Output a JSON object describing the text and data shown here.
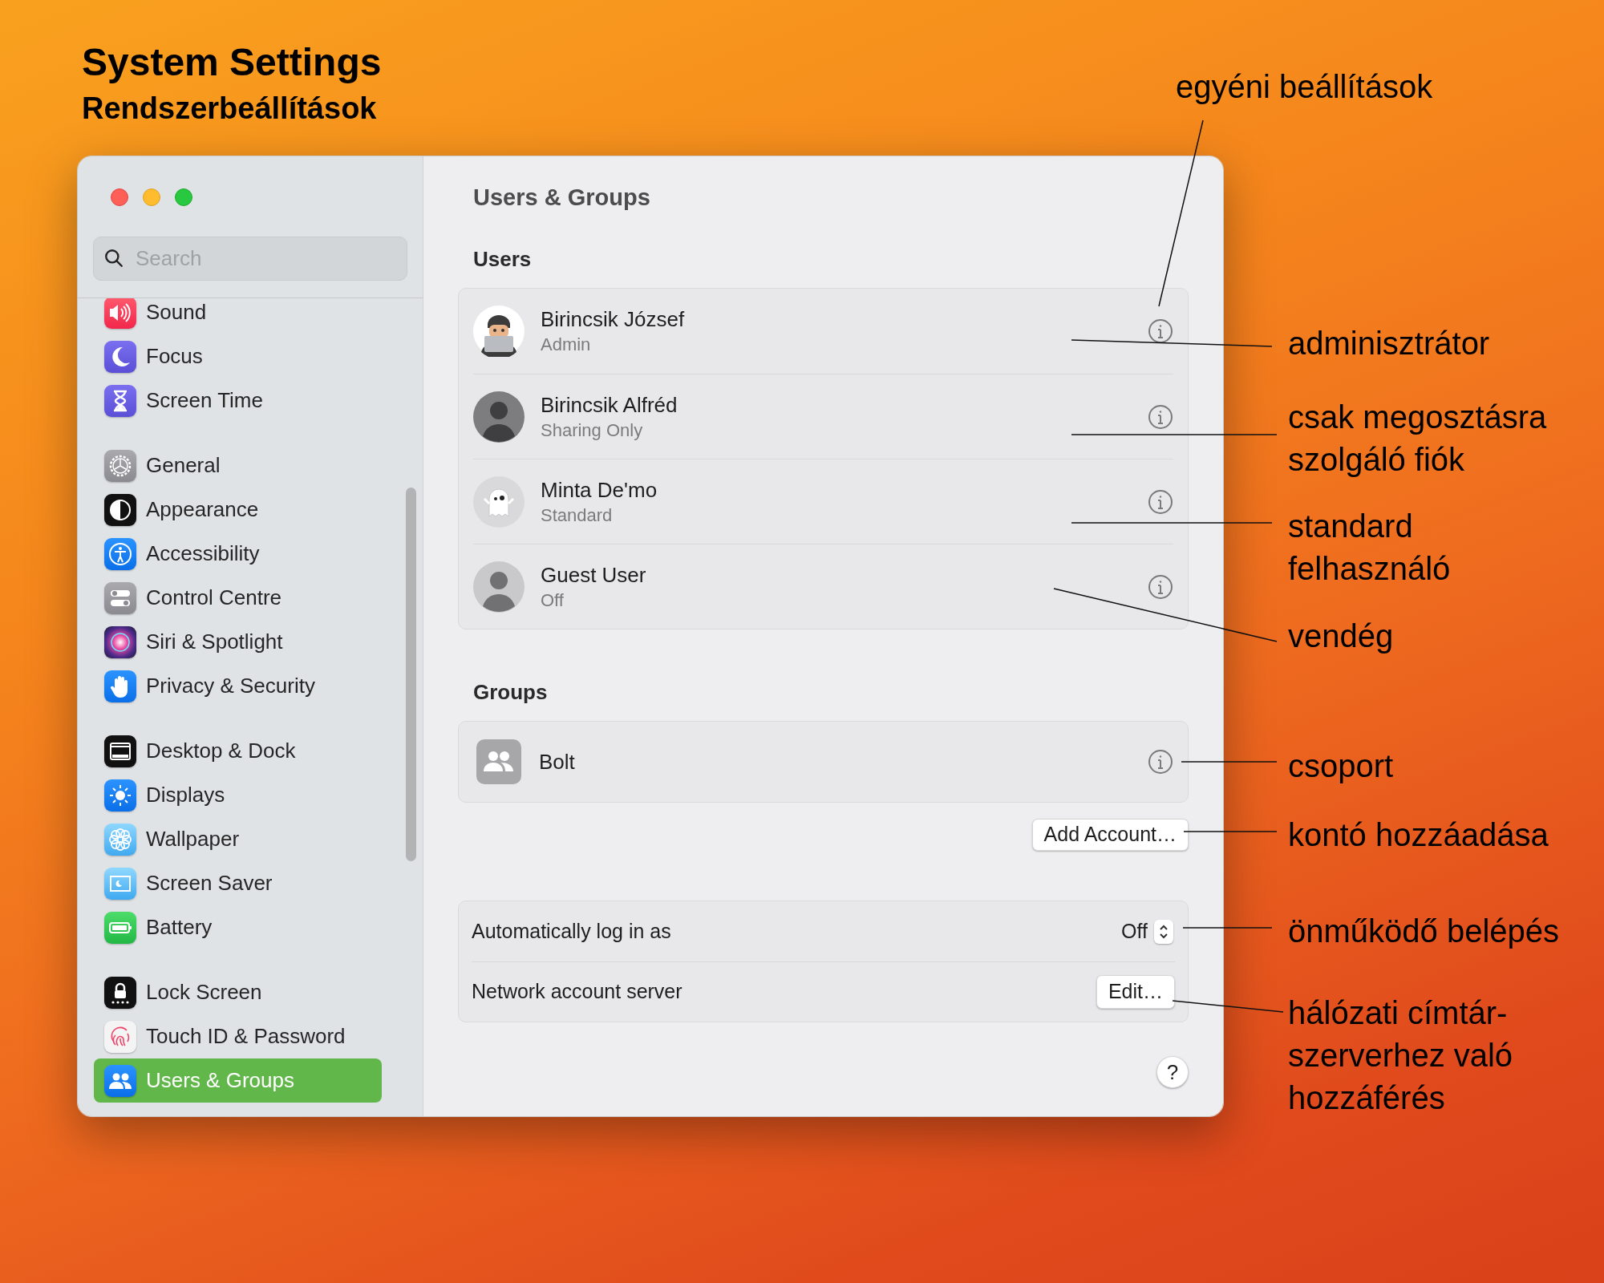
{
  "heading": {
    "title": "System Settings",
    "subtitle": "Rendszerbeállítások"
  },
  "window": {
    "sidebar": {
      "search": {
        "placeholder": "Search"
      },
      "sections": [
        {
          "items": [
            {
              "label": "Sound",
              "kind": "sound",
              "selected": false
            },
            {
              "label": "Focus",
              "kind": "focus",
              "selected": false
            },
            {
              "label": "Screen Time",
              "kind": "screentime",
              "selected": false
            }
          ]
        },
        {
          "items": [
            {
              "label": "General",
              "kind": "general",
              "selected": false
            },
            {
              "label": "Appearance",
              "kind": "appearance",
              "selected": false
            },
            {
              "label": "Accessibility",
              "kind": "accessibility",
              "selected": false
            },
            {
              "label": "Control Centre",
              "kind": "control",
              "selected": false
            },
            {
              "label": "Siri & Spotlight",
              "kind": "siri",
              "selected": false
            },
            {
              "label": "Privacy & Security",
              "kind": "privacy",
              "selected": false
            }
          ]
        },
        {
          "items": [
            {
              "label": "Desktop & Dock",
              "kind": "dock",
              "selected": false
            },
            {
              "label": "Displays",
              "kind": "displays",
              "selected": false
            },
            {
              "label": "Wallpaper",
              "kind": "wallpaper",
              "selected": false
            },
            {
              "label": "Screen Saver",
              "kind": "screensaver",
              "selected": false
            },
            {
              "label": "Battery",
              "kind": "battery",
              "selected": false
            }
          ]
        },
        {
          "items": [
            {
              "label": "Lock Screen",
              "kind": "lock",
              "selected": false
            },
            {
              "label": "Touch ID & Password",
              "kind": "touchid",
              "selected": false
            },
            {
              "label": "Users & Groups",
              "kind": "users",
              "selected": true
            }
          ]
        }
      ]
    },
    "main": {
      "title": "Users & Groups",
      "users_heading": "Users",
      "users": [
        {
          "name": "Birincsik József",
          "role": "Admin",
          "kind": "memoji"
        },
        {
          "name": "Birincsik Alfréd",
          "role": "Sharing Only",
          "kind": "silhouette"
        },
        {
          "name": "Minta De'mo",
          "role": "Standard",
          "kind": "ghost"
        },
        {
          "name": "Guest User",
          "role": "Off",
          "kind": "guest"
        }
      ],
      "groups_heading": "Groups",
      "groups": [
        {
          "name": "Bolt"
        }
      ],
      "add_account": "Add Account…",
      "settings": [
        {
          "kind": "stepper",
          "label": "Automatically log in as",
          "value": "Off"
        },
        {
          "kind": "button",
          "label": "Network account server",
          "button": "Edit…"
        }
      ],
      "help": "?"
    }
  },
  "annotations": [
    {
      "lines": [
        "egyéni beállítások"
      ]
    },
    {
      "lines": [
        "adminisztrátor"
      ]
    },
    {
      "lines": [
        "csak megosztásra",
        "szolgáló fiók"
      ]
    },
    {
      "lines": [
        "standard",
        "felhasználó"
      ]
    },
    {
      "lines": [
        "vendég"
      ]
    },
    {
      "lines": [
        "csoport"
      ]
    },
    {
      "lines": [
        "kontó hozzáadása"
      ]
    },
    {
      "lines": [
        "önműködő belépés"
      ]
    },
    {
      "lines": [
        "hálózati címtár-",
        "szerverhez való",
        "hozzáférés"
      ]
    }
  ]
}
